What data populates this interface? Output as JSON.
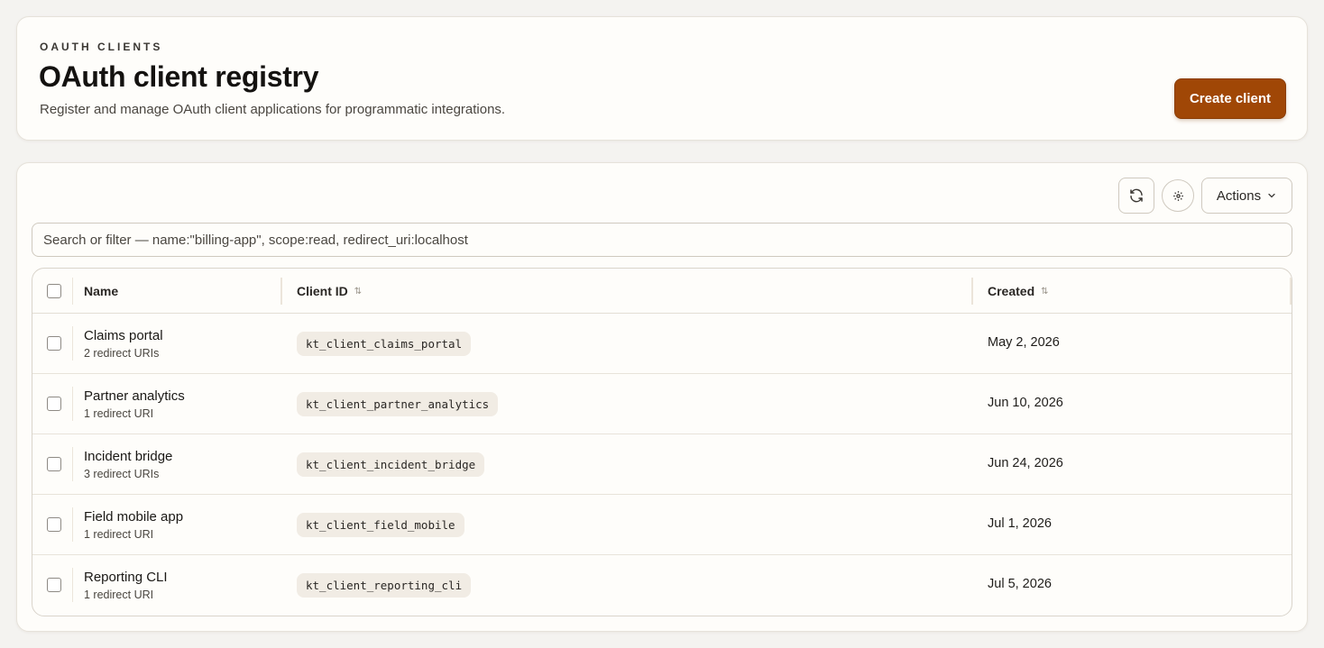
{
  "header": {
    "eyebrow": "OAUTH CLIENTS",
    "title": "OAuth client registry",
    "subtitle": "Register and manage OAuth client applications for programmatic integrations.",
    "create_label": "Create client"
  },
  "toolbar": {
    "refresh_icon": "refresh-icon",
    "settings_icon": "gear-icon",
    "actions_label": "Actions"
  },
  "search": {
    "placeholder": "Search or filter — name:\"billing-app\", scope:read, redirect_uri:localhost",
    "value": ""
  },
  "table": {
    "columns": [
      "Name",
      "Client ID",
      "Created"
    ],
    "rows": [
      {
        "name": "Claims portal",
        "sub": "2 redirect URIs",
        "client_id": "kt_client_claims_portal",
        "created": "May 2, 2026"
      },
      {
        "name": "Partner analytics",
        "sub": "1 redirect URI",
        "client_id": "kt_client_partner_analytics",
        "created": "Jun 10, 2026"
      },
      {
        "name": "Incident bridge",
        "sub": "3 redirect URIs",
        "client_id": "kt_client_incident_bridge",
        "created": "Jun 24, 2026"
      },
      {
        "name": "Field mobile app",
        "sub": "1 redirect URI",
        "client_id": "kt_client_field_mobile",
        "created": "Jul 1, 2026"
      },
      {
        "name": "Reporting CLI",
        "sub": "1 redirect URI",
        "client_id": "kt_client_reporting_cli",
        "created": "Jul 5, 2026"
      }
    ]
  },
  "colors": {
    "accent": "#a04706",
    "background": "#f4f3f0",
    "card": "#fefdfa"
  }
}
